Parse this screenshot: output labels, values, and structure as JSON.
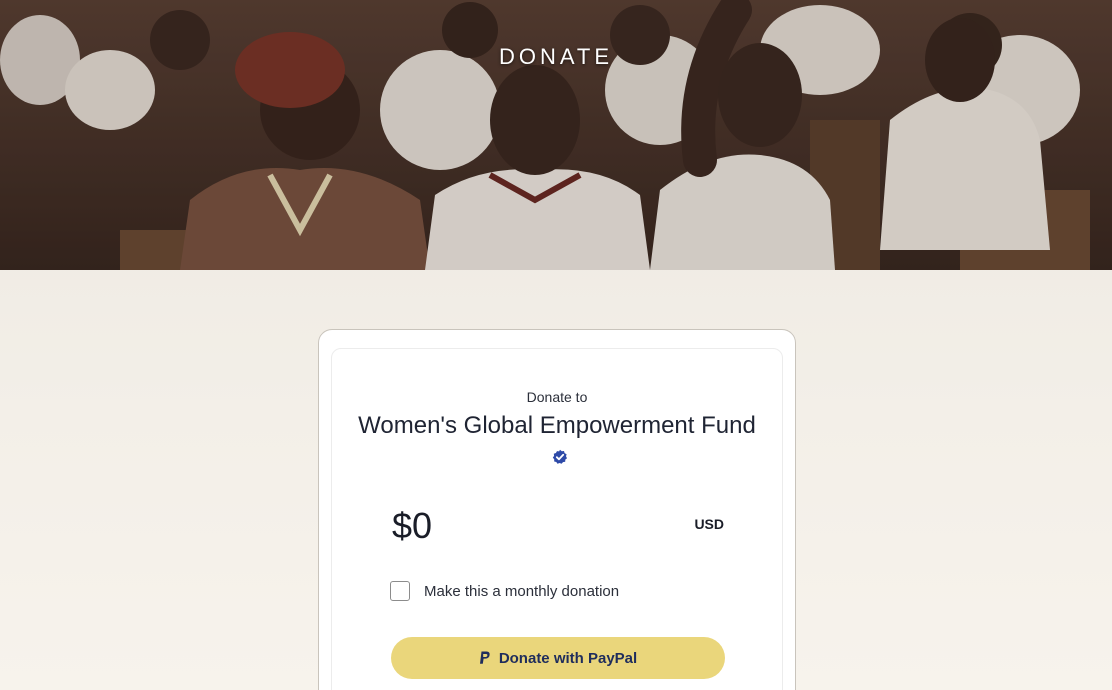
{
  "hero": {
    "title": "DONATE",
    "image_description_icon": "classroom-photo"
  },
  "card": {
    "donate_to_label": "Donate to",
    "organization_name": "Women's Global Empowerment Fund",
    "verified_icon": "verified-check-icon",
    "amount": "$0",
    "currency": "USD",
    "monthly_label": "Make this a monthly donation",
    "monthly_checked": false,
    "paypal_button_label": "Donate with PayPal",
    "paypal_icon": "paypal-icon"
  },
  "colors": {
    "paypal_button": "#ead67b",
    "paypal_text": "#1f2d5c",
    "verified_badge": "#2e4aa8",
    "background": "#ece7df"
  }
}
